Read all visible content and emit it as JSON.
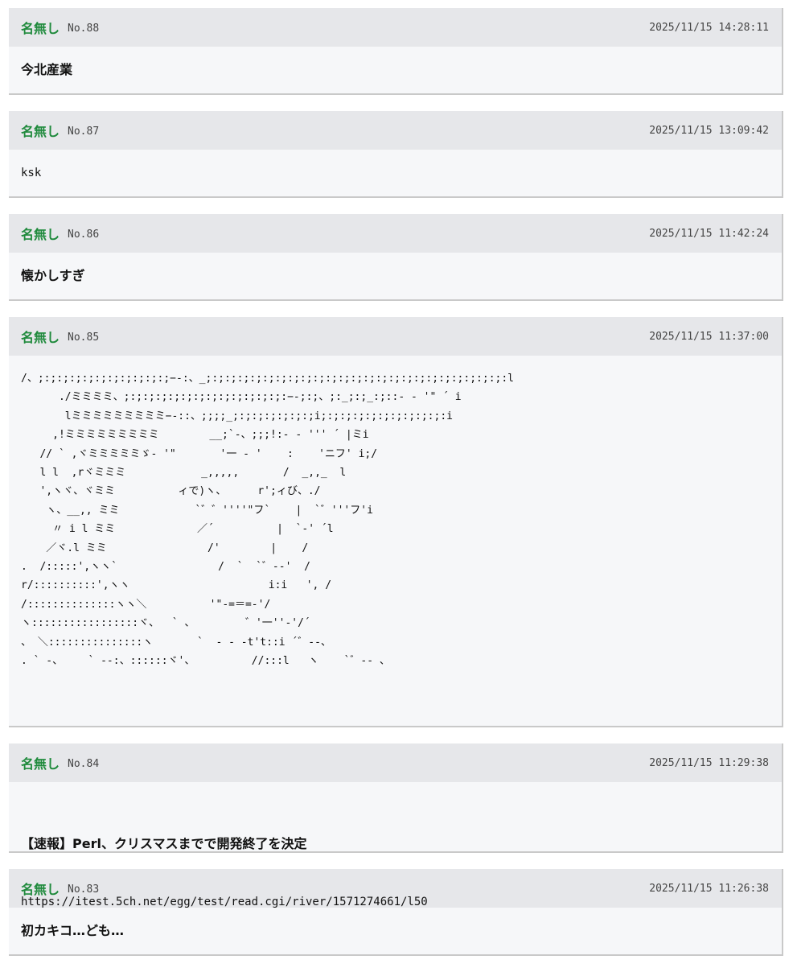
{
  "posts": [
    {
      "name": "名無し",
      "no": "No.88",
      "datetime": "2025/11/15 14:28:11",
      "body": "今北産業"
    },
    {
      "name": "名無し",
      "no": "No.87",
      "datetime": "2025/11/15 13:09:42",
      "body": "ksk"
    },
    {
      "name": "名無し",
      "no": "No.86",
      "datetime": "2025/11/15 11:42:24",
      "body": "懐かしすぎ"
    },
    {
      "name": "名無し",
      "no": "No.85",
      "datetime": "2025/11/15 11:37:00",
      "body": "/、;:;:;:;:;:;:;:;:;:;:;−-:、_;:;:;:;:;:;:;:;:;:;:;:;:;:;:;:;:;:;:;:;:;:;:;:;:l\n      ./ミミミミ、;:;:;:;:;:;:;:;:;:;:;:;:;:−-;:;、;:_;:;_:;::- - '\" ´ i\n       lミミミミミミミミミ−-::、;;;;_;:;:;:;:;:;:;i;:;:;:;:;:;:;:;:;:;:i\n     ,!ミミミミミミミミミ        __;`-、;;;!:- - ''' ´ |ミi\n   // ` ,ヾミミミミミゞ- '\"       '一 - '    :    'ニフ' i;/\n   l l  ,rヾミミミ            _,,,,,       /  _,,_  l\n   ',ヽヾ、ヾミミ          ィで)ヽ、     r';ィび、./\n    ヽ、__,, ミミ            `゛゛''''\"フ`    |  `゛'''フ'i\n     〃 i l ミミ             ／´          |  `-' ´l\n    ／ヾ.l ミミ                /'        |    /\n.  /:::::',ヽヽ`                /  `  `゛--'  /\nr/::::::::::',ヽヽ                      i:i   ', /\n/::::::::::::::ヽヽ＼          '\"-=＝=-'/\nヽ:::::::::::::::::ヾ、  ` 、        ゛'一''-'/´\n、 ＼:::::::::::::::ヽ       `  - - -t't::i ´゛--、\n. ` -、    ` --:、::::::ヾ'、         //:::l   ヽ    `゛-- 、"
    },
    {
      "name": "名無し",
      "no": "No.84",
      "datetime": "2025/11/15 11:29:38",
      "title": "【速報】Perl、クリスマスまでで開発終了を決定",
      "url": "https://itest.5ch.net/egg/test/read.cgi/river/1571274661/l50"
    },
    {
      "name": "名無し",
      "no": "No.83",
      "datetime": "2025/11/15 11:26:38",
      "body": "初カキコ…ども…"
    }
  ]
}
